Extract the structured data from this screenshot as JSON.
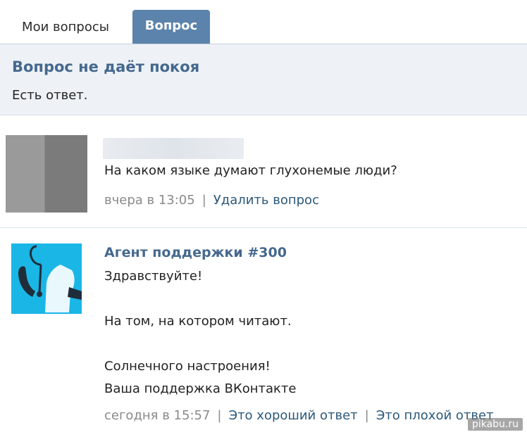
{
  "tabs": [
    {
      "label": "Мои вопросы",
      "active": false
    },
    {
      "label": "Вопрос",
      "active": true
    }
  ],
  "header": {
    "title": "Вопрос не даёт покоя",
    "subtitle": "Есть ответ."
  },
  "question": {
    "text": "На каком языке думают глухонемые люди?",
    "time": "вчера в 13:05",
    "delete_label": "Удалить вопрос"
  },
  "answer": {
    "author": "Агент поддержки #300",
    "lines": [
      "Здравствуйте!",
      "На том, на котором читают.",
      "Солнечного настроения!",
      "Ваша поддержка ВКонтакте"
    ],
    "time": "сегодня в 15:57",
    "good_label": "Это хороший ответ",
    "bad_label": "Это плохой ответ"
  },
  "watermark": "pikabu.ru",
  "colors": {
    "accent": "#5b83ab",
    "link": "#2b587a",
    "title": "#45688e",
    "header_bg": "#eef2f6",
    "avatar_bg": "#1ab6e6"
  }
}
